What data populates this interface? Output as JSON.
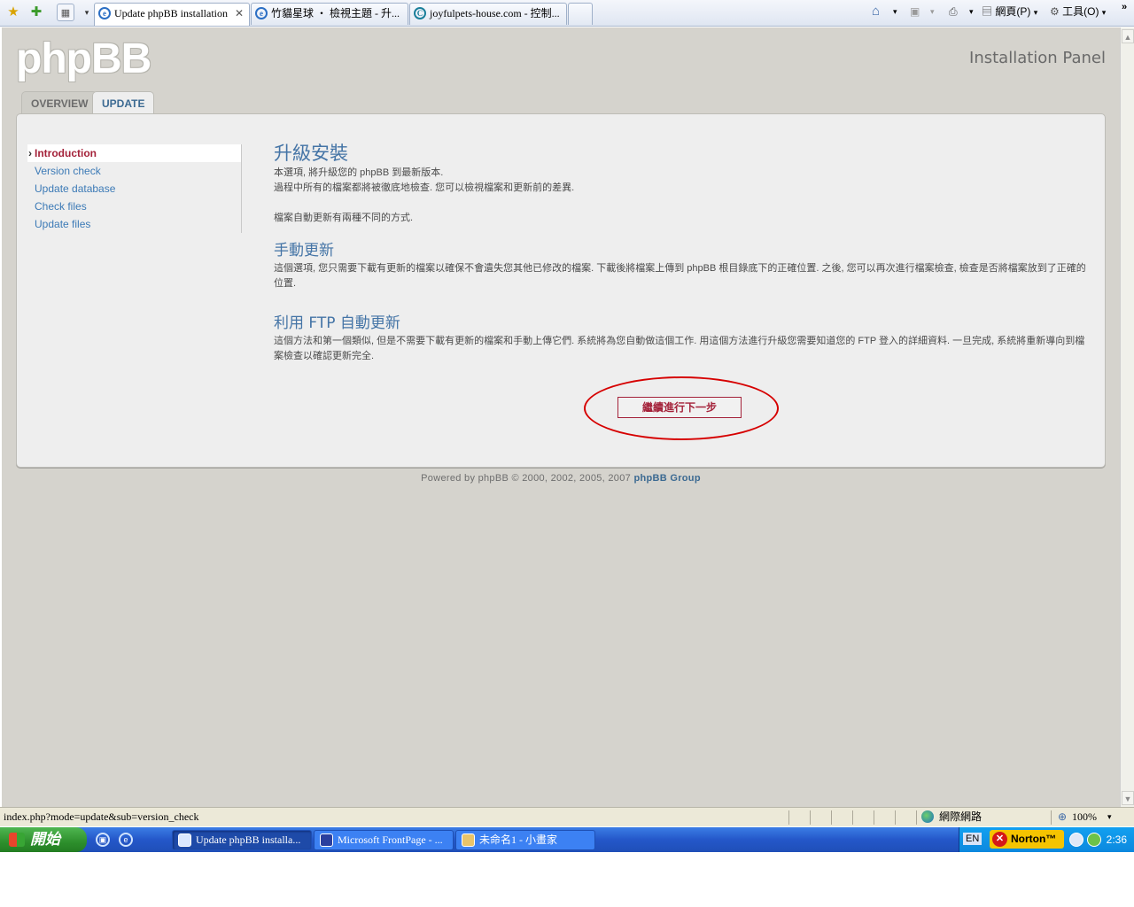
{
  "browser": {
    "tabs": [
      {
        "title": "Update phpBB installation",
        "active": true
      },
      {
        "title": "竹貓星球 ‧ 檢視主題 - 升...",
        "active": false
      },
      {
        "title": "joyfulpets-house.com - 控制...",
        "active": false
      }
    ],
    "commands": {
      "page_label": "網頁(P)",
      "tools_label": "工具(O)"
    }
  },
  "page": {
    "logo_text": "phpBB",
    "panel_title": "Installation Panel",
    "tabs": [
      {
        "label": "OVERVIEW",
        "active": false
      },
      {
        "label": "UPDATE",
        "active": true
      }
    ],
    "menu": [
      {
        "label": "Introduction",
        "active": true
      },
      {
        "label": "Version check"
      },
      {
        "label": "Update database"
      },
      {
        "label": "Check files"
      },
      {
        "label": "Update files"
      }
    ],
    "content": {
      "title": "升級安裝",
      "intro_lines": [
        "本選項, 將升級您的 phpBB 到最新版本.",
        "過程中所有的檔案都將被徹底地檢查. 您可以檢視檔案和更新前的差異.",
        "檔案自動更新有兩種不同的方式."
      ],
      "manual_heading": "手動更新",
      "manual_text": "這個選項, 您只需要下載有更新的檔案以確保不會遺失您其他已修改的檔案. 下載後將檔案上傳到 phpBB 根目錄底下的正確位置. 之後, 您可以再次進行檔案檢查, 檢查是否將檔案放到了正確的位置.",
      "ftp_heading": "利用 FTP 自動更新",
      "ftp_text": "這個方法和第一個類似, 但是不需要下載有更新的檔案和手動上傳它們. 系統將為您自動做這個工作. 用這個方法進行升級您需要知道您的 FTP 登入的詳細資料. 一旦完成, 系統將重新導向到檔案檢查以確認更新完全.",
      "submit_label": "繼續進行下一步"
    },
    "footer": {
      "text": "Powered by phpBB © 2000, 2002, 2005, 2007",
      "link": "phpBB Group"
    }
  },
  "statusbar": {
    "url": "index.php?mode=update&sub=version_check",
    "zone": "網際網路",
    "zoom": "100%"
  },
  "taskbar": {
    "start_label": "開始",
    "tasks": [
      {
        "label": "Update phpBB installa...",
        "active": true
      },
      {
        "label": "Microsoft FrontPage - ...",
        "active": false
      },
      {
        "label": "未命名1 - 小畫家",
        "active": false
      }
    ],
    "lang": "EN",
    "norton": "Norton™",
    "clock": "2:36"
  },
  "colors": {
    "accent": "#4474a6",
    "link": "#3c7ab6",
    "active_menu": "#a4223a",
    "highlight_ellipse": "#d60000"
  }
}
